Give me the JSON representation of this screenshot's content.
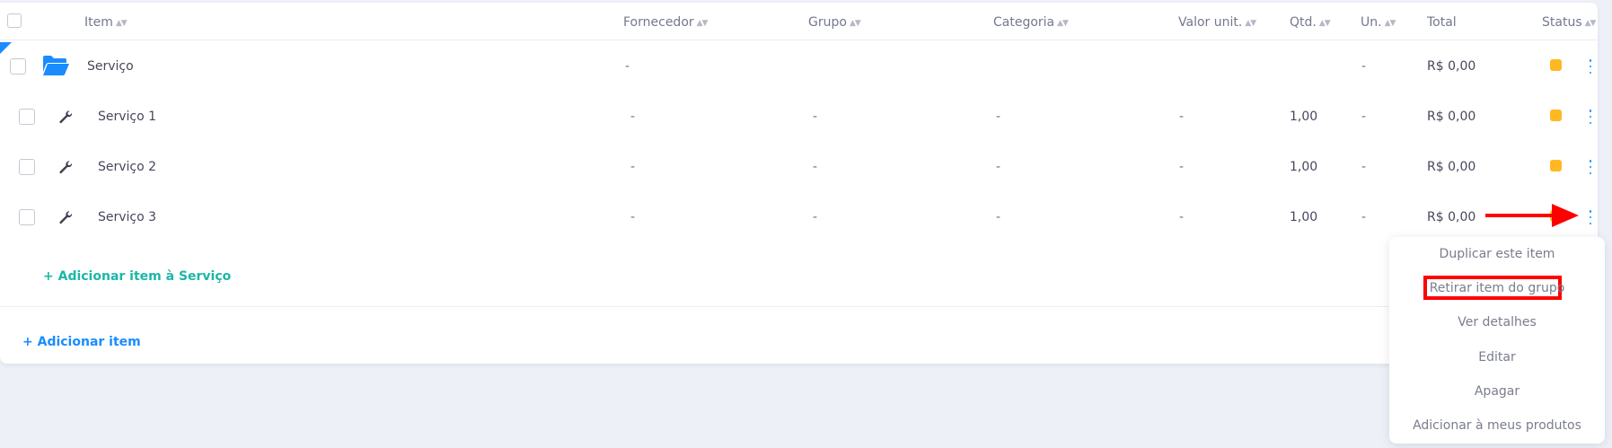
{
  "headers": {
    "item": "Item",
    "fornecedor": "Fornecedor",
    "grupo": "Grupo",
    "categoria": "Categoria",
    "valor_unit": "Valor unit.",
    "qtd": "Qtd.",
    "un": "Un.",
    "total": "Total",
    "status": "Status"
  },
  "group_row": {
    "name": "Serviço",
    "fornecedor": "-",
    "un": "-",
    "total": "R$ 0,00",
    "status_color": "#ffb822"
  },
  "items": [
    {
      "name": "Serviço 1",
      "fornecedor": "-",
      "grupo": "-",
      "categoria": "-",
      "valor_unit": "-",
      "qtd": "1,00",
      "un": "-",
      "total": "R$ 0,00"
    },
    {
      "name": "Serviço 2",
      "fornecedor": "-",
      "grupo": "-",
      "categoria": "-",
      "valor_unit": "-",
      "qtd": "1,00",
      "un": "-",
      "total": "R$ 0,00"
    },
    {
      "name": "Serviço 3",
      "fornecedor": "-",
      "grupo": "-",
      "categoria": "-",
      "valor_unit": "-",
      "qtd": "1,00",
      "un": "-",
      "total": "R$ 0,00"
    }
  ],
  "add_to_group_link": "+ Adicionar item à Serviço",
  "add_item_link": "+ Adicionar item",
  "context_menu": {
    "duplicate": "Duplicar este item",
    "remove_from_group": "Retirar item do grupo",
    "details": "Ver detalhes",
    "edit": "Editar",
    "delete": "Apagar",
    "add_to_products": "Adicionar à meus produtos"
  },
  "colors": {
    "accent_blue": "#1a8cff",
    "teal_link": "#1cb7a6",
    "status_yellow": "#ffb822",
    "annotation_red": "#ff0000"
  }
}
